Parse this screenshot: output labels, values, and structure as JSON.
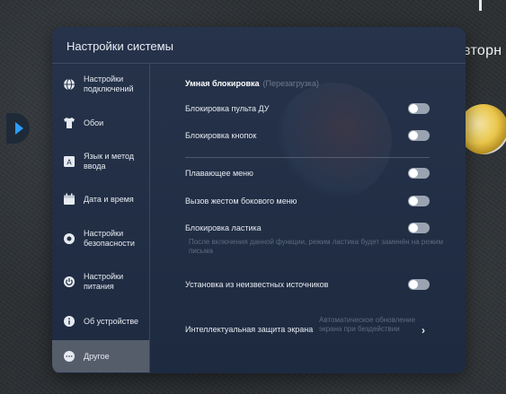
{
  "background": {
    "partial_text": "вторн"
  },
  "panel": {
    "title": "Настройки системы"
  },
  "sidebar": {
    "items": [
      {
        "label": "Настройки подключений",
        "icon": "globe-icon",
        "active": false
      },
      {
        "label": "Обои",
        "icon": "shirt-icon",
        "active": false
      },
      {
        "label": "Язык и метод ввода",
        "icon": "language-a-icon",
        "active": false
      },
      {
        "label": "Дата и время",
        "icon": "calendar-icon",
        "active": false
      },
      {
        "label": "Настройки безопасности",
        "icon": "shield-icon",
        "active": false
      },
      {
        "label": "Настройки питания",
        "icon": "power-icon",
        "active": false
      },
      {
        "label": "Об устройстве",
        "icon": "info-icon",
        "active": false
      },
      {
        "label": "Другое",
        "icon": "more-dots-icon",
        "active": true
      }
    ]
  },
  "content": {
    "section_title": "Умная блокировка",
    "section_subtitle": "(Перезагрузка)",
    "rows": [
      {
        "label": "Блокировка пульта ДУ",
        "enabled": false
      },
      {
        "label": "Блокировка кнопок",
        "enabled": false
      },
      {
        "label": "Плавающее меню",
        "enabled": false
      },
      {
        "label": "Вызов жестом бокового меню",
        "enabled": false
      },
      {
        "label": "Блокировка ластика",
        "enabled": false
      },
      {
        "label": "Установка из неизвестных источников",
        "enabled": false
      }
    ],
    "eraser_hint": "После включения данной функции, режим ластика будет заменён на режим письма",
    "screen_protection": {
      "label": "Интеллектуальная защита экрана",
      "value": "Автоматическое обновление экрана при бездействии"
    }
  },
  "colors": {
    "panel_bg": "#223048",
    "active_item_bg": "#555d6b",
    "toggle_off": "#9aa3b1",
    "accent_arrow": "#2d9cff"
  }
}
